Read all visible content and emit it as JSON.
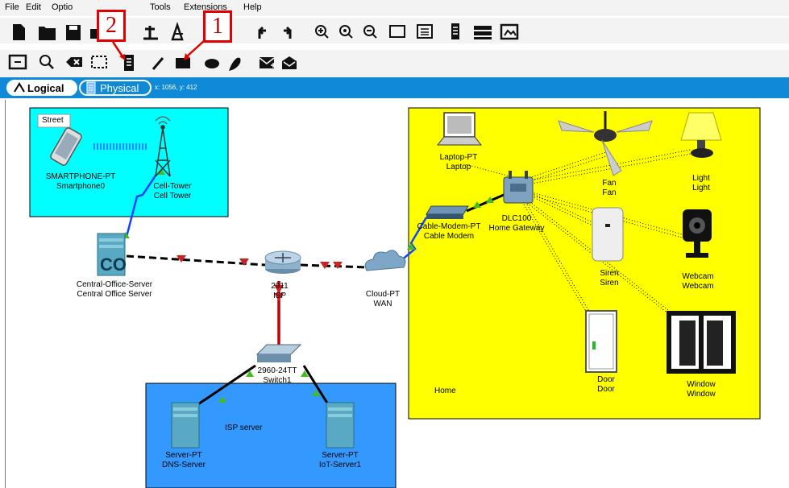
{
  "menu": {
    "file": "File",
    "edit": "Edit",
    "options": "Optio",
    "tools": "Tools",
    "extensions": "Extensions",
    "help": "Help"
  },
  "tabs": {
    "logical": "Logical",
    "physical": "Physical",
    "coords": "x: 1056, y: 412"
  },
  "callouts": {
    "one": "1",
    "two": "2"
  },
  "clusters": {
    "street": "Street",
    "home": "Home",
    "isp": "ISP server"
  },
  "devices": {
    "smartphone": {
      "model": "SMARTPHONE-PT",
      "name": "Smartphone0"
    },
    "celltower": {
      "model": "Cell-Tower",
      "name": "Cell Tower"
    },
    "co_server": {
      "model": "Central-Office-Server",
      "name": "Central Office Server",
      "badge": "CO"
    },
    "router": {
      "model": "2911",
      "name": "ISP"
    },
    "cloud": {
      "model": "Cloud-PT",
      "name": "WAN"
    },
    "switch": {
      "model": "2960-24TT",
      "name": "Switch1"
    },
    "dns": {
      "model": "Server-PT",
      "name": "DNS-Server"
    },
    "iot": {
      "model": "Server-PT",
      "name": "IoT-Server1"
    },
    "laptop": {
      "model": "Laptop-PT",
      "name": "Laptop"
    },
    "modem": {
      "model": "Cable-Modem-PT",
      "name": "Cable Modem"
    },
    "gateway": {
      "model": "DLC100",
      "name": "Home Gateway"
    },
    "fan": {
      "model": "Fan",
      "name": "Fan"
    },
    "light": {
      "model": "Light",
      "name": "Light"
    },
    "siren": {
      "model": "Siren",
      "name": "Siren"
    },
    "webcam": {
      "model": "Webcam",
      "name": "Webcam"
    },
    "door": {
      "model": "Door",
      "name": "Door"
    },
    "window": {
      "model": "Window",
      "name": "Window"
    }
  },
  "colors": {
    "street_bg": "#00ffff",
    "home_bg": "#ffff00",
    "isp_bg": "#3399ff",
    "tabbar": "#0e8ad6",
    "callout": "#e30000"
  }
}
